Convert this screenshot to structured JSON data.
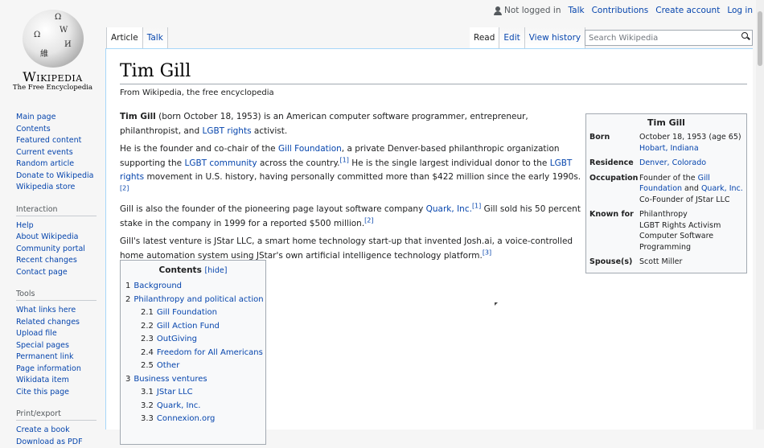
{
  "personal": {
    "not_logged_in": "Not logged in",
    "talk": "Talk",
    "contributions": "Contributions",
    "create_account": "Create account",
    "login": "Log in"
  },
  "logo": {
    "wordmark": "Wikipedia",
    "tagline": "The Free Encyclopedia"
  },
  "sidebar": {
    "main": [
      "Main page",
      "Contents",
      "Featured content",
      "Current events",
      "Random article",
      "Donate to Wikipedia",
      "Wikipedia store"
    ],
    "interaction_heading": "Interaction",
    "interaction": [
      "Help",
      "About Wikipedia",
      "Community portal",
      "Recent changes",
      "Contact page"
    ],
    "tools_heading": "Tools",
    "tools": [
      "What links here",
      "Related changes",
      "Upload file",
      "Special pages",
      "Permanent link",
      "Page information",
      "Wikidata item",
      "Cite this page"
    ],
    "print_heading": "Print/export",
    "print": [
      "Create a book",
      "Download as PDF"
    ]
  },
  "tabs": {
    "article": "Article",
    "talk": "Talk",
    "read": "Read",
    "edit": "Edit",
    "view_history": "View history"
  },
  "search": {
    "placeholder": "Search Wikipedia"
  },
  "article": {
    "title": "Tim Gill",
    "site_sub": "From Wikipedia, the free encyclopedia",
    "p1": {
      "name": "Tim Gill",
      "t1": " (born October 18, 1953) is an American computer software programmer, entrepreneur, philanthropist, and ",
      "link1": "LGBT rights",
      "t2": " activist."
    },
    "p2": {
      "t1": "He is the founder and co-chair of the ",
      "link1": "Gill Foundation",
      "t2": ", a private Denver-based philanthropic organization supporting the ",
      "link2": "LGBT community",
      "t3": " across the country.",
      "ref1": "[1]",
      "t4": " He is the single largest individual donor to the ",
      "link3": "LGBT rights",
      "t5": " movement in U.S. history, having personally committed more than $422 million since the early 1990s.",
      "ref2": "[2]"
    },
    "p3": {
      "t1": "Gill is also the founder of the pioneering page layout software company ",
      "link1": "Quark, Inc.",
      "ref1": "[1]",
      "t2": " Gill sold his 50 percent stake in the company in 1999 for a reported $500 million.",
      "ref2": "[2]"
    },
    "p4": {
      "t1": "Gill's latest venture is JStar LLC, a smart home technology start-up that invented Josh.ai, a voice-controlled home automation system using JStar's own artificial intelligence technology platform.",
      "ref1": "[3]"
    }
  },
  "toc": {
    "title": "Contents",
    "hide": "[hide]",
    "items": [
      {
        "num": "1",
        "label": "Background",
        "level": 1
      },
      {
        "num": "2",
        "label": "Philanthropy and political action",
        "level": 1
      },
      {
        "num": "2.1",
        "label": "Gill Foundation",
        "level": 2
      },
      {
        "num": "2.2",
        "label": "Gill Action Fund",
        "level": 2
      },
      {
        "num": "2.3",
        "label": "OutGiving",
        "level": 2
      },
      {
        "num": "2.4",
        "label": "Freedom for All Americans",
        "level": 2
      },
      {
        "num": "2.5",
        "label": "Other",
        "level": 2
      },
      {
        "num": "3",
        "label": "Business ventures",
        "level": 1
      },
      {
        "num": "3.1",
        "label": "JStar LLC",
        "level": 2
      },
      {
        "num": "3.2",
        "label": "Quark, Inc.",
        "level": 2
      },
      {
        "num": "3.3",
        "label": "Connexion.org",
        "level": 2
      }
    ]
  },
  "infobox": {
    "title": "Tim Gill",
    "born_label": "Born",
    "born_date": "October 18, 1953 (age 65)",
    "born_place": "Hobart, Indiana",
    "residence_label": "Residence",
    "residence": "Denver, Colorado",
    "occupation_label": "Occupation",
    "occ_t1": "Founder of the ",
    "occ_link1": "Gill Foundation",
    "occ_t2": " and ",
    "occ_link2": "Quark, Inc.",
    "occ_t3": "Co-Founder of JStar LLC",
    "known_label": "Known for",
    "known": [
      "Philanthropy",
      "LGBT Rights Activism",
      "Computer Software Programming"
    ],
    "spouse_label": "Spouse(s)",
    "spouse": "Scott Miller"
  }
}
